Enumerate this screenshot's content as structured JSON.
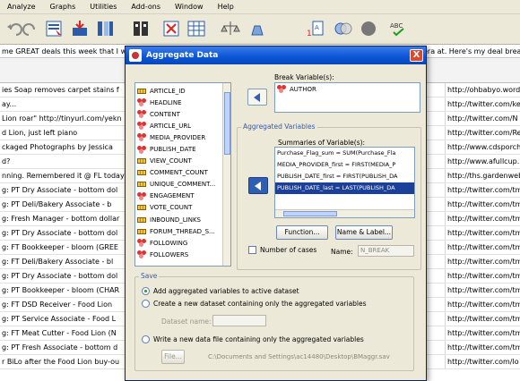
{
  "menu": [
    "Analyze",
    "Graphs",
    "Utilities",
    "Add-ons",
    "Window",
    "Help"
  ],
  "infobar": "me GREAT deals this week that I wante",
  "infobar_right": "era at. Here's my deal breakd",
  "rows": [
    {
      "c1": "ies Soap removes carpet stains f",
      "c2": "http://ohbabyo.word"
    },
    {
      "c1": "ay...",
      "c2": "http://twitter.com/ke"
    },
    {
      "c1": "Lion roar\" http://tinyurl.com/yekn",
      "c2": "http://twitter.com/N"
    },
    {
      "c1": "d Lion, just left piano",
      "c2": "http://twitter.com/Re"
    },
    {
      "c1": "ckaged Photographs by Jessica",
      "c2": "http://www.cdsporch"
    },
    {
      "c1": "d?",
      "c2": "http://www.afullcup."
    },
    {
      "c1": "nning. Remembered it @ FL today",
      "c2": "http://ths.gardenweb"
    },
    {
      "c1": "g: PT Dry Associate - bottom dol",
      "c2": "http://twitter.com/tm"
    },
    {
      "c1": "g: PT Deli/Bakery Associate - b",
      "c2": "http://twitter.com/tm"
    },
    {
      "c1": "g: Fresh Manager - bottom dollar",
      "c2": "http://twitter.com/tm"
    },
    {
      "c1": "g: PT Dry Associate - bottom dol",
      "c2": "http://twitter.com/tm"
    },
    {
      "c1": "g: FT Bookkeeper - bloom (GREE",
      "c2": "http://twitter.com/tm"
    },
    {
      "c1": "g: FT Deli/Bakery Associate - bl",
      "c2": "http://twitter.com/tm"
    },
    {
      "c1": "g: PT Dry Associate - bottom dol",
      "c2": "http://twitter.com/tm"
    },
    {
      "c1": "g: PT Bookkeeper - bloom (CHAR",
      "c2": "http://twitter.com/tm"
    },
    {
      "c1": "g: FT DSD Receiver - Food Lion",
      "c2": "http://twitter.com/tm"
    },
    {
      "c1": "g: PT Service Associate - Food L",
      "c2": "http://twitter.com/tm"
    },
    {
      "c1": "g: FT Meat Cutter - Food Lion (N",
      "c2": "http://twitter.com/tm"
    },
    {
      "c1": "g: PT Fresh Associate - bottom d",
      "c2": "http://twitter.com/tm"
    },
    {
      "c1": "r BiLo after the Food Lion buy-ou",
      "c2": "http://twitter.com/lo"
    }
  ],
  "dialog": {
    "title": "Aggregate Data",
    "close": "X",
    "variables": [
      {
        "name": "ARTICLE_ID",
        "type": "ruler"
      },
      {
        "name": "HEADLINE",
        "type": "nom"
      },
      {
        "name": "CONTENT",
        "type": "nom"
      },
      {
        "name": "ARTICLE_URL",
        "type": "nom"
      },
      {
        "name": "MEDIA_PROVIDER",
        "type": "nom"
      },
      {
        "name": "PUBLISH_DATE",
        "type": "nom"
      },
      {
        "name": "VIEW_COUNT",
        "type": "ruler"
      },
      {
        "name": "COMMENT_COUNT",
        "type": "ruler"
      },
      {
        "name": "UNIQUE_COMMENT...",
        "type": "ruler"
      },
      {
        "name": "ENGAGEMENT",
        "type": "nom"
      },
      {
        "name": "VOTE_COUNT",
        "type": "ruler"
      },
      {
        "name": "INBOUND_LINKS",
        "type": "ruler"
      },
      {
        "name": "FORUM_THREAD_S...",
        "type": "ruler"
      },
      {
        "name": "FOLLOWING",
        "type": "nom"
      },
      {
        "name": "FOLLOWERS",
        "type": "nom"
      }
    ],
    "break_label": "Break Variable(s):",
    "break_items": [
      "AUTHOR"
    ],
    "aggregated_legend": "Aggregated Variables",
    "summaries_label": "Summaries of Variable(s):",
    "summaries": [
      "Purchase_Flag_sum = SUM(Purchase_Fla",
      "MEDIA_PROVIDER_first = FIRST(MEDIA_P",
      "PUBLISH_DATE_first = FIRST(PUBLISH_DA",
      "PUBLISH_DATE_last = LAST(PUBLISH_DA"
    ],
    "function_btn": "Function...",
    "namelabel_btn": "Name & Label...",
    "number_of_cases": "Number of cases",
    "name_label": "Name:",
    "name_value": "N_BREAK",
    "save_legend": "Save",
    "opt_add": "Add aggregated variables to active dataset",
    "opt_create": "Create a new dataset containing only the aggregated variables",
    "dataset_name_label": "Dataset name:",
    "opt_write": "Write a new data file containing only the aggregated variables",
    "file_btn": "File...",
    "file_path": "C:\\Documents and Settings\\ac14480\\Desktop\\BMaggr.sav"
  }
}
